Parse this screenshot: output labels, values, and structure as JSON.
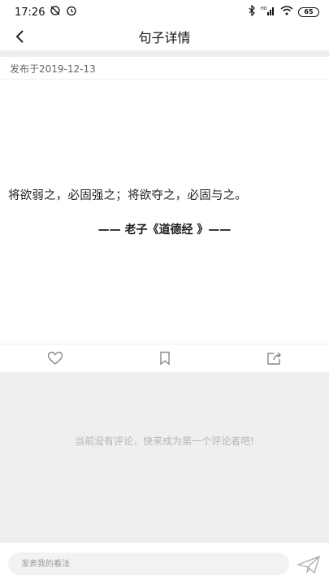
{
  "status_bar": {
    "time": "17:26",
    "signal_label": "HD",
    "battery": "65"
  },
  "header": {
    "title": "句子详情"
  },
  "post": {
    "publish_date": "发布于2019-12-13",
    "quote": "将欲弱之，必固强之；将欲夺之，必固与之。",
    "source": "—— 老子《道德经 》——"
  },
  "actions": {
    "icons": [
      "heart-icon",
      "bookmark-icon",
      "share-icon"
    ]
  },
  "comments": {
    "empty_text": "当前没有评论，快来成为第一个评论者吧!"
  },
  "comment_input": {
    "placeholder": "发表我的看法"
  },
  "colors": {
    "background": "#ffffff",
    "comment_area": "#efefef",
    "input_bg": "#f2f2f2",
    "muted_text": "#b5b5b5",
    "icon": "#888888"
  }
}
